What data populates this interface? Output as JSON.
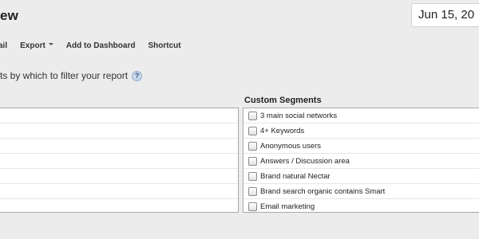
{
  "header": {
    "title": "ew",
    "date": "Jun 15, 20"
  },
  "toolbar": {
    "email_label": "ail",
    "export_label": "Export",
    "add_to_dashboard_label": "Add to Dashboard",
    "shortcut_label": "Shortcut"
  },
  "filter": {
    "hint": "ts by which to filter your report",
    "help_icon": "?"
  },
  "custom_segments": {
    "heading": "Custom Segments",
    "items": [
      {
        "label": "3 main social networks",
        "checked": false
      },
      {
        "label": "4+ Keywords",
        "checked": false
      },
      {
        "label": "Anonymous users",
        "checked": false
      },
      {
        "label": "Answers / Discussion area",
        "checked": false
      },
      {
        "label": "Brand natural Nectar",
        "checked": false
      },
      {
        "label": "Brand search organic contains Smart",
        "checked": false
      },
      {
        "label": "Email marketing",
        "checked": false
      }
    ]
  }
}
